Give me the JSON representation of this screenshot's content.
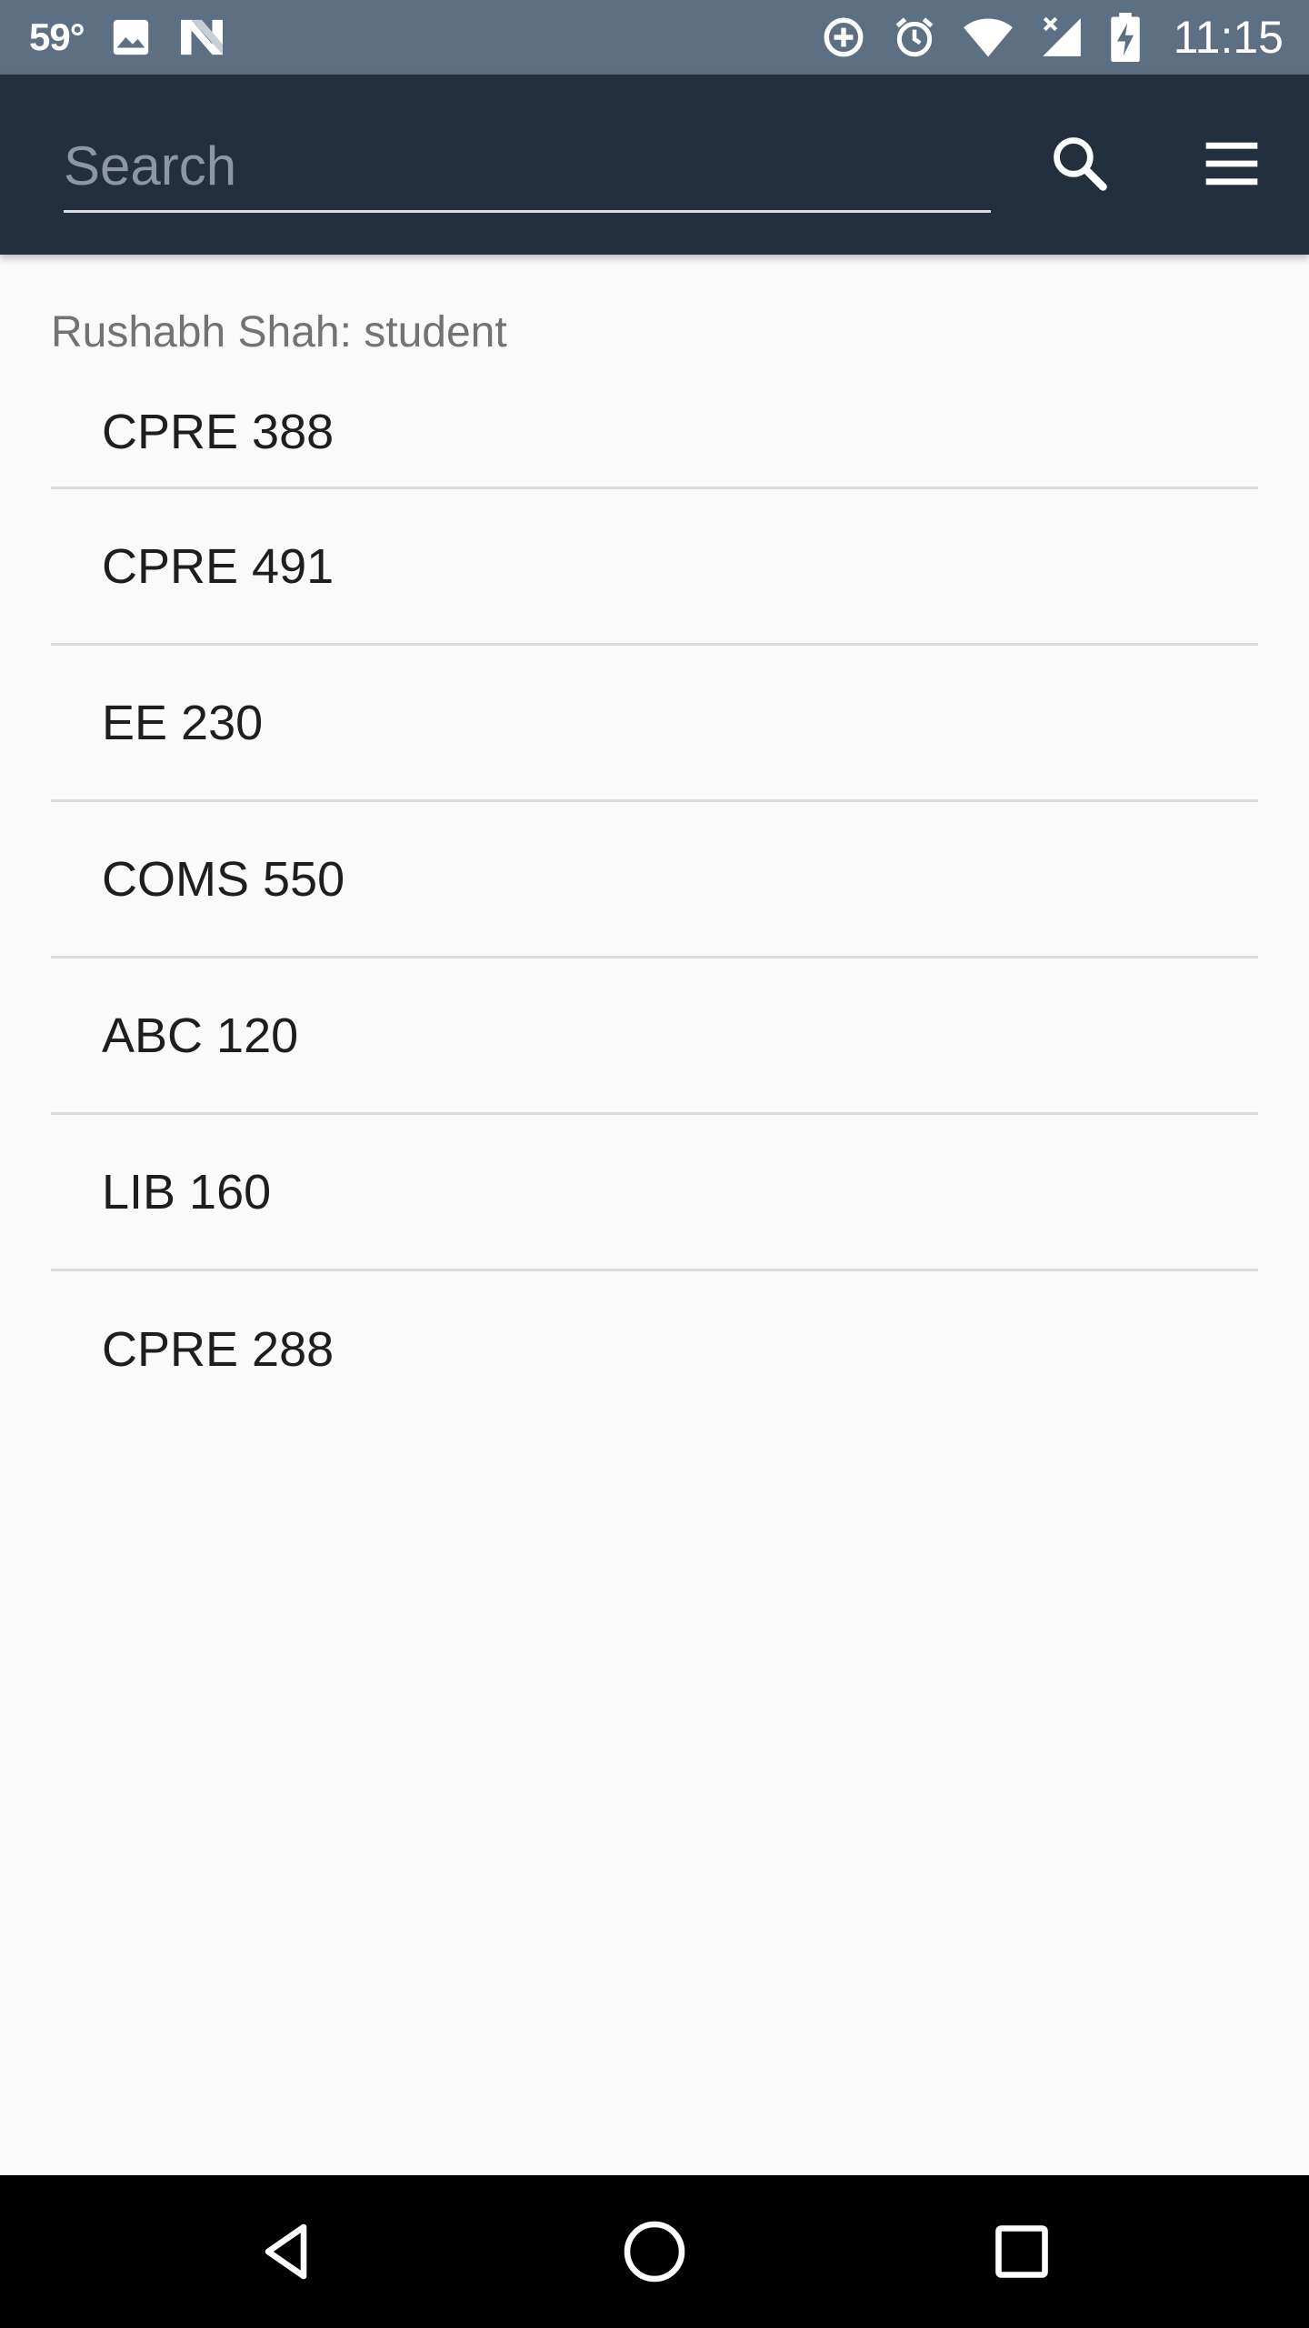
{
  "status_bar": {
    "temperature": "59°",
    "time": "11:15",
    "icons": [
      "image-icon",
      "n-app-icon",
      "data-saver-icon",
      "alarm-icon",
      "wifi-icon",
      "signal-icon",
      "battery-charging-icon"
    ]
  },
  "app_bar": {
    "search_placeholder": "Search",
    "search_value": "",
    "search_icon": "search-icon",
    "menu_icon": "menu-icon"
  },
  "content": {
    "user_header": "Rushabh Shah: student",
    "courses": [
      "CPRE 388",
      "CPRE 491",
      "EE 230",
      "COMS 550",
      "ABC 120",
      "LIB 160",
      "CPRE 288"
    ]
  },
  "nav_bar": {
    "icons": [
      "back-icon",
      "home-icon",
      "recents-icon"
    ]
  },
  "colors": {
    "status_bar_bg": "#5d6f82",
    "app_bar_bg": "#232f3d",
    "page_bg": "#fafafa",
    "divider": "#dcdcdc",
    "nav_bar_bg": "#000000"
  }
}
